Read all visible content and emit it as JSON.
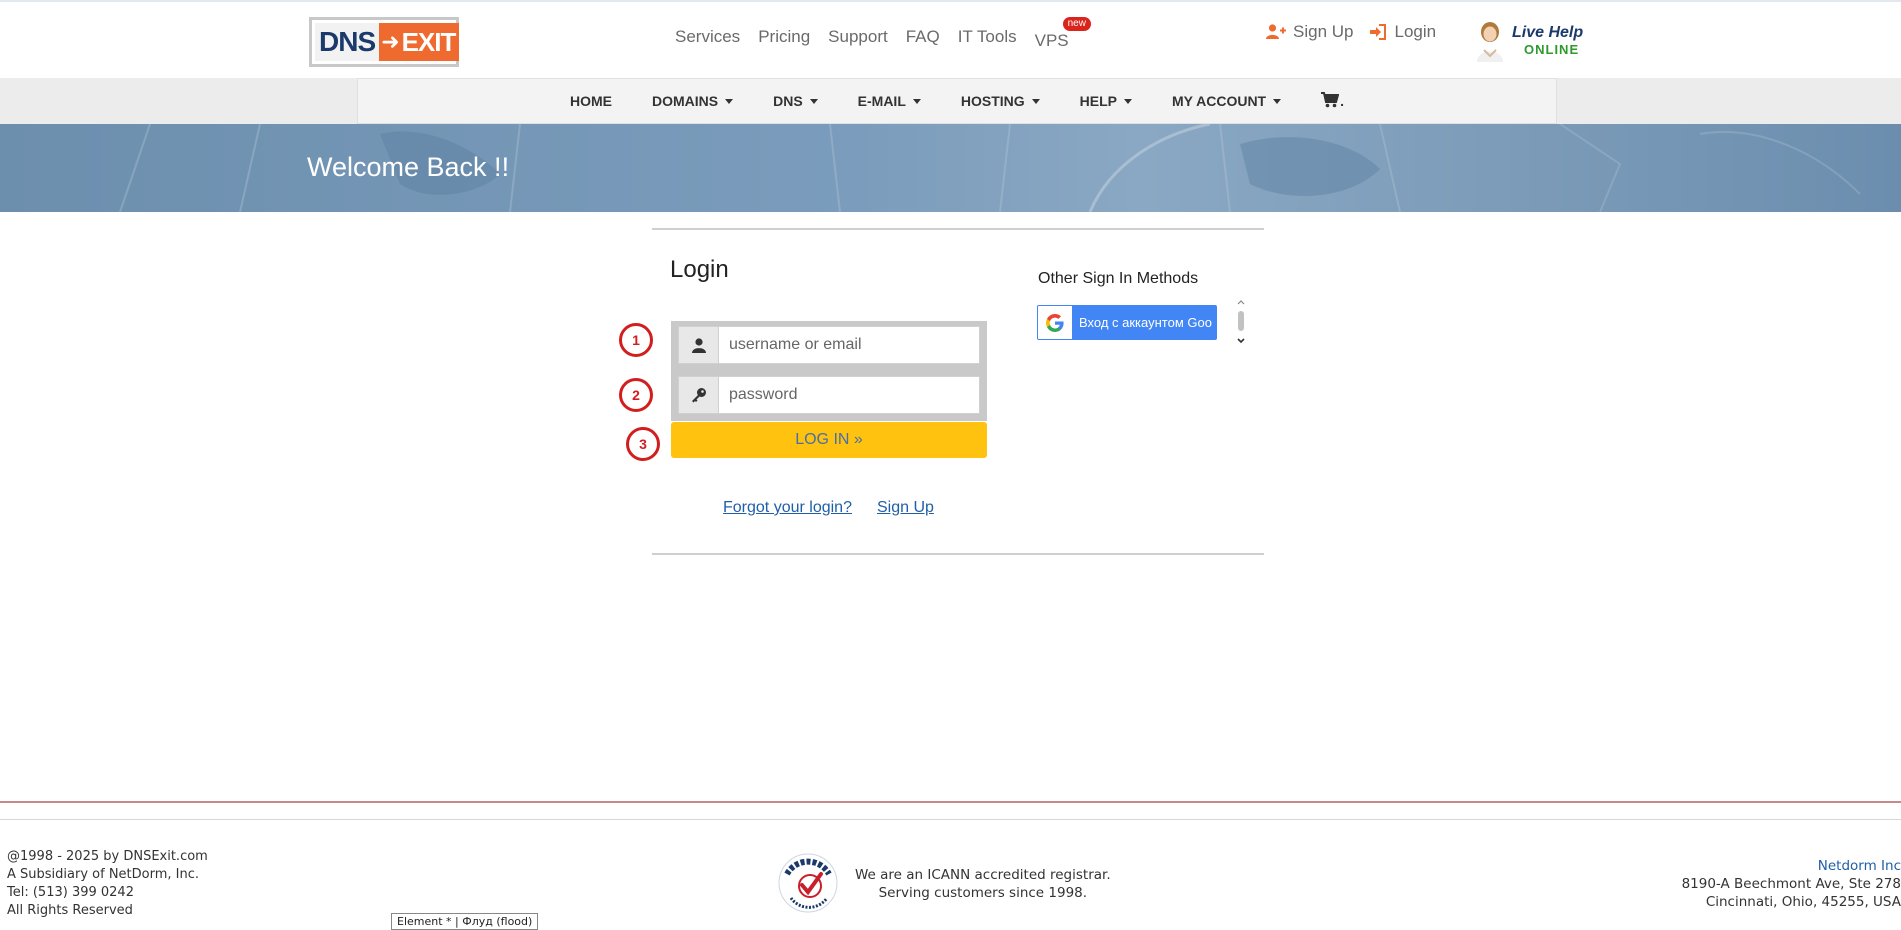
{
  "header": {
    "logo": {
      "left": "DNS",
      "arrow": "➜",
      "right": "EXIT"
    },
    "topnav": [
      {
        "label": "Services"
      },
      {
        "label": "Pricing"
      },
      {
        "label": "Support"
      },
      {
        "label": "FAQ"
      },
      {
        "label": "IT Tools"
      },
      {
        "label": "VPS",
        "badge": "new"
      }
    ],
    "auth": {
      "signup": "Sign Up",
      "login": "Login"
    },
    "livehelp": {
      "title": "Live Help",
      "status": "ONLINE"
    }
  },
  "mainnav": [
    {
      "label": "HOME",
      "dropdown": false
    },
    {
      "label": "DOMAINS",
      "dropdown": true
    },
    {
      "label": "DNS",
      "dropdown": true
    },
    {
      "label": "E-MAIL",
      "dropdown": true
    },
    {
      "label": "HOSTING",
      "dropdown": true
    },
    {
      "label": "HELP",
      "dropdown": true
    },
    {
      "label": "MY ACCOUNT",
      "dropdown": true
    },
    {
      "label": ".",
      "dropdown": false,
      "icon": "cart-icon"
    }
  ],
  "banner": {
    "title": "Welcome Back !!"
  },
  "login": {
    "title": "Login",
    "username_placeholder": "username or email",
    "username_value": "",
    "password_placeholder": "password",
    "password_value": "",
    "button": "LOG IN »",
    "markers": [
      "1",
      "2",
      "3"
    ],
    "forgot": "Forgot your login?",
    "signup": "Sign Up"
  },
  "other_signin": {
    "title": "Other Sign In Methods",
    "google_label": "Вход с аккаунтом Goo"
  },
  "footer": {
    "left": [
      "@1998 - 2025 by DNSExit.com",
      "A Subsidiary of NetDorm, Inc.",
      "Tel: (513) 399 0242",
      "All Rights Reserved"
    ],
    "icann_lines": [
      "We are an ICANN accredited registrar.",
      "Serving customers since 1998."
    ],
    "company": "Netdorm Inc",
    "address": [
      "8190-A Beechmont Ave, Ste 278",
      "Cincinnati, Ohio, 45255, USA"
    ],
    "tooltip": "Element * | Флуд (flood)"
  },
  "colors": {
    "accent_orange": "#ef6a2f",
    "button_yellow": "#ffc20e",
    "link_blue": "#1f5fa8",
    "marker_red": "#d21e1e",
    "banner_blue": "#6d8fae"
  }
}
